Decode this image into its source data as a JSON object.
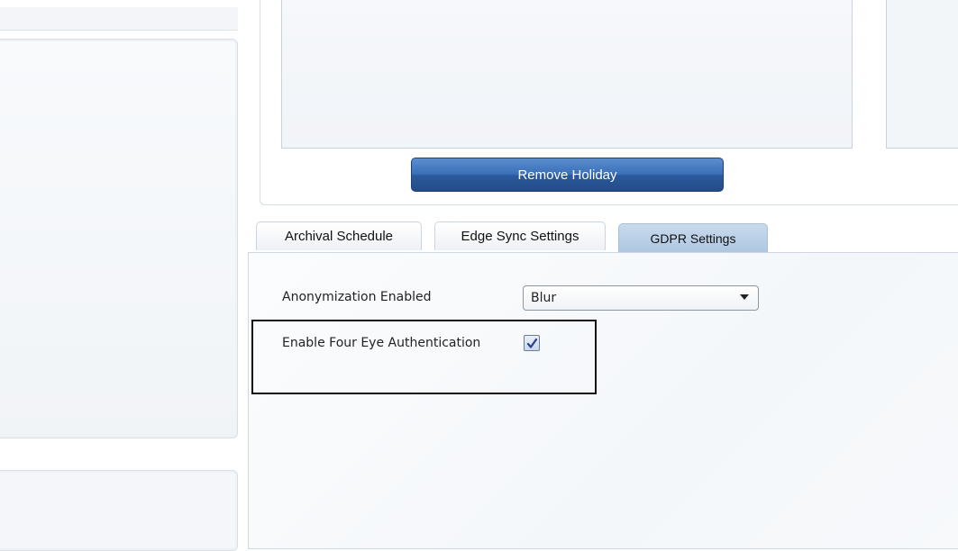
{
  "actions": {
    "remove_holiday_label": "Remove Holiday"
  },
  "tabs": [
    {
      "label": "Archival Schedule",
      "selected": false
    },
    {
      "label": "Edge Sync Settings",
      "selected": false
    },
    {
      "label": "GDPR Settings",
      "selected": true
    }
  ],
  "gdpr": {
    "anonymization_label": "Anonymization Enabled",
    "anonymization_value": "Blur",
    "four_eye_label": "Enable Four Eye Authentication",
    "four_eye_checked": true
  },
  "colors": {
    "primary_button": "#2b5a9e",
    "selected_tab": "#b6cde6",
    "checkmark": "#2a3f8f"
  },
  "icons": {
    "dropdown": "chevron-down-icon",
    "check": "check-icon"
  }
}
